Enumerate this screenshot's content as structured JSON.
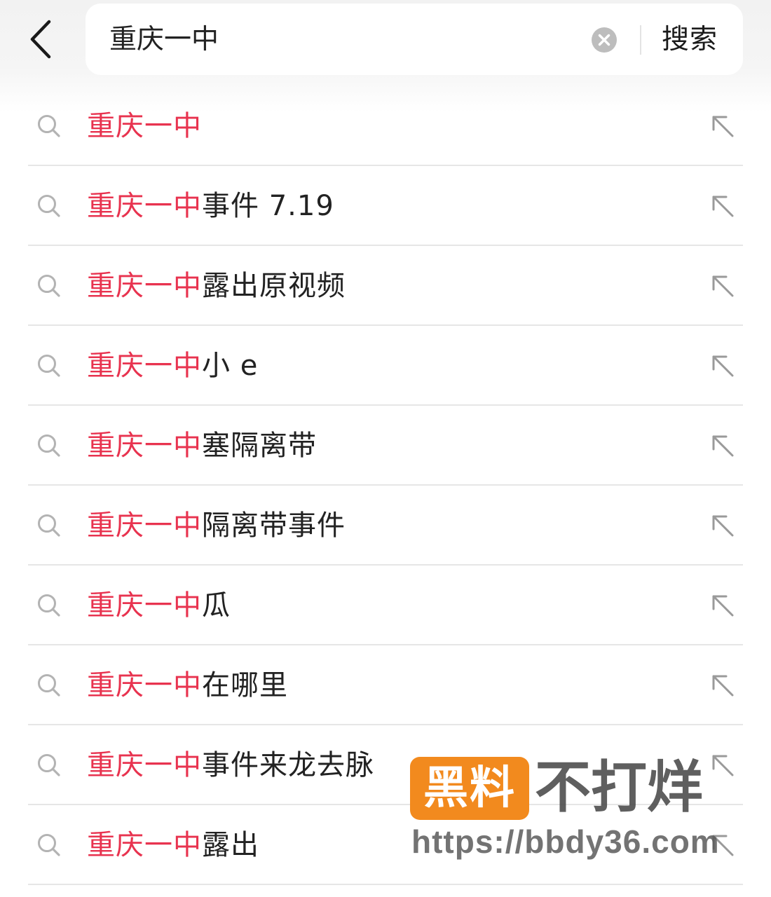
{
  "header": {
    "back_icon": "chevron-left-icon",
    "search": {
      "query": "重庆一中",
      "clear_icon": "clear-circle-icon",
      "submit_label": "搜索"
    }
  },
  "suggestions": [
    {
      "highlight": "重庆一中",
      "rest": ""
    },
    {
      "highlight": "重庆一中",
      "rest": "事件 7.19"
    },
    {
      "highlight": "重庆一中",
      "rest": "露出原视频"
    },
    {
      "highlight": "重庆一中",
      "rest": "小 e"
    },
    {
      "highlight": "重庆一中",
      "rest": "塞隔离带"
    },
    {
      "highlight": "重庆一中",
      "rest": "隔离带事件"
    },
    {
      "highlight": "重庆一中",
      "rest": "瓜"
    },
    {
      "highlight": "重庆一中",
      "rest": "在哪里"
    },
    {
      "highlight": "重庆一中",
      "rest": "事件来龙去脉"
    },
    {
      "highlight": "重庆一中",
      "rest": "露出"
    }
  ],
  "suggestion_icons": {
    "leading": "search-icon",
    "trailing": "arrow-up-left-icon"
  },
  "colors": {
    "highlight": "#e8334f",
    "text": "#222222",
    "watermark_badge": "#f28a1e"
  },
  "watermark": {
    "badge": "黑料",
    "title": "不打烊",
    "url": "https://bbdy36.com"
  }
}
